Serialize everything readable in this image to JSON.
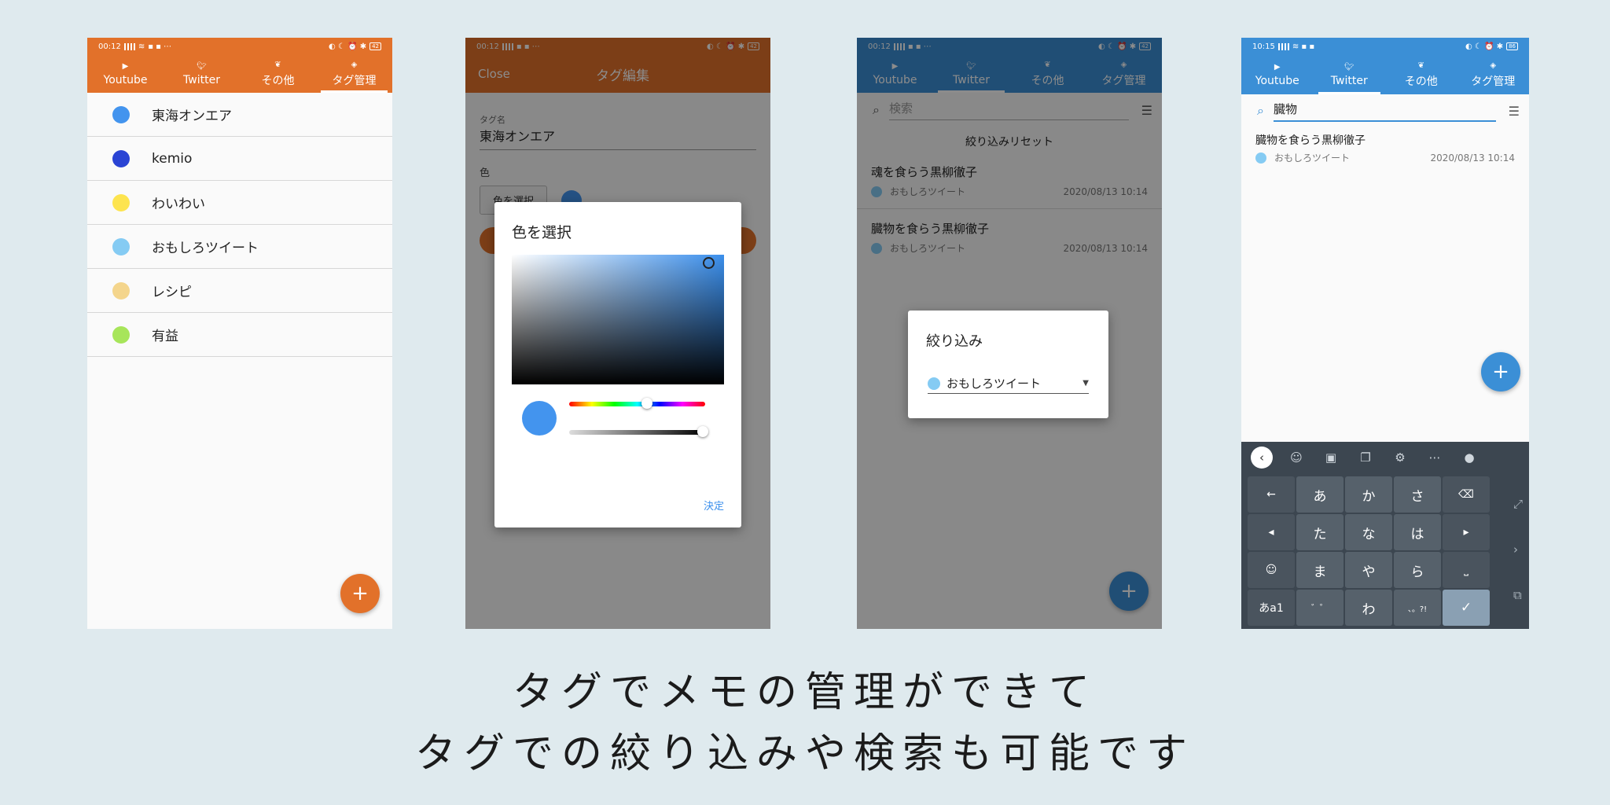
{
  "screens": {
    "tag_list": {
      "status": {
        "time": "00:12",
        "battery": "42"
      },
      "tabs": [
        {
          "label": "Youtube",
          "icon": "youtube-icon"
        },
        {
          "label": "Twitter",
          "icon": "twitter-icon"
        },
        {
          "label": "その他",
          "icon": "leaf-icon"
        },
        {
          "label": "タグ管理",
          "icon": "tag-icon"
        }
      ],
      "active_tab": "タグ管理",
      "tags": [
        {
          "name": "東海オンエア",
          "color": "#4394ee"
        },
        {
          "name": "kemio",
          "color": "#2a44d4"
        },
        {
          "name": "わいわい",
          "color": "#fde44f"
        },
        {
          "name": "おもしろツイート",
          "color": "#85cbf3"
        },
        {
          "name": "レシピ",
          "color": "#f4d58c"
        },
        {
          "name": "有益",
          "color": "#a7e55a"
        }
      ],
      "fab": "+"
    },
    "tag_edit": {
      "status": {
        "time": "00:12",
        "battery": "42"
      },
      "appbar": {
        "close": "Close",
        "title": "タグ編集"
      },
      "form": {
        "name_label": "タグ名",
        "name_value": "東海オンエア",
        "color_label": "色",
        "pick_button": "色を選択"
      },
      "color_dialog": {
        "title": "色を選択",
        "confirm": "決定",
        "selected_color": "#4394ee",
        "hue": "#3b8fec"
      }
    },
    "twitter_filter": {
      "status": {
        "time": "00:12",
        "battery": "42"
      },
      "tabs": [
        {
          "label": "Youtube"
        },
        {
          "label": "Twitter"
        },
        {
          "label": "その他"
        },
        {
          "label": "タグ管理"
        }
      ],
      "active_tab": "Twitter",
      "search_placeholder": "検索",
      "reset": "絞り込みリセット",
      "items": [
        {
          "title": "魂を食らう黒柳徹子",
          "tag": "おもしろツイート",
          "date": "2020/08/13 10:14"
        },
        {
          "title": "臓物を食らう黒柳徹子",
          "tag": "おもしろツイート",
          "date": "2020/08/13 10:14"
        }
      ],
      "filter_dialog": {
        "title": "絞り込み",
        "selected": "おもしろツイート"
      },
      "fab": "+"
    },
    "twitter_search": {
      "status": {
        "time": "10:15",
        "battery": "86"
      },
      "tabs": [
        {
          "label": "Youtube"
        },
        {
          "label": "Twitter"
        },
        {
          "label": "その他"
        },
        {
          "label": "タグ管理"
        }
      ],
      "active_tab": "Twitter",
      "search_value": "臓物",
      "items": [
        {
          "title": "臓物を食らう黒柳徹子",
          "tag": "おもしろツイート",
          "date": "2020/08/13 10:14"
        }
      ],
      "fab": "+",
      "keyboard": {
        "keys": [
          "←",
          "あ",
          "か",
          "さ",
          "⌫",
          "◂",
          "た",
          "な",
          "は",
          "▸",
          "☺",
          "ま",
          "や",
          "ら",
          "⎵",
          "あa1",
          "゛゜",
          "わ",
          "、。?!",
          "✓"
        ]
      }
    }
  },
  "caption": {
    "line1": "タグでメモの管理ができて",
    "line2": "タグでの絞り込みや検索も可能です"
  }
}
